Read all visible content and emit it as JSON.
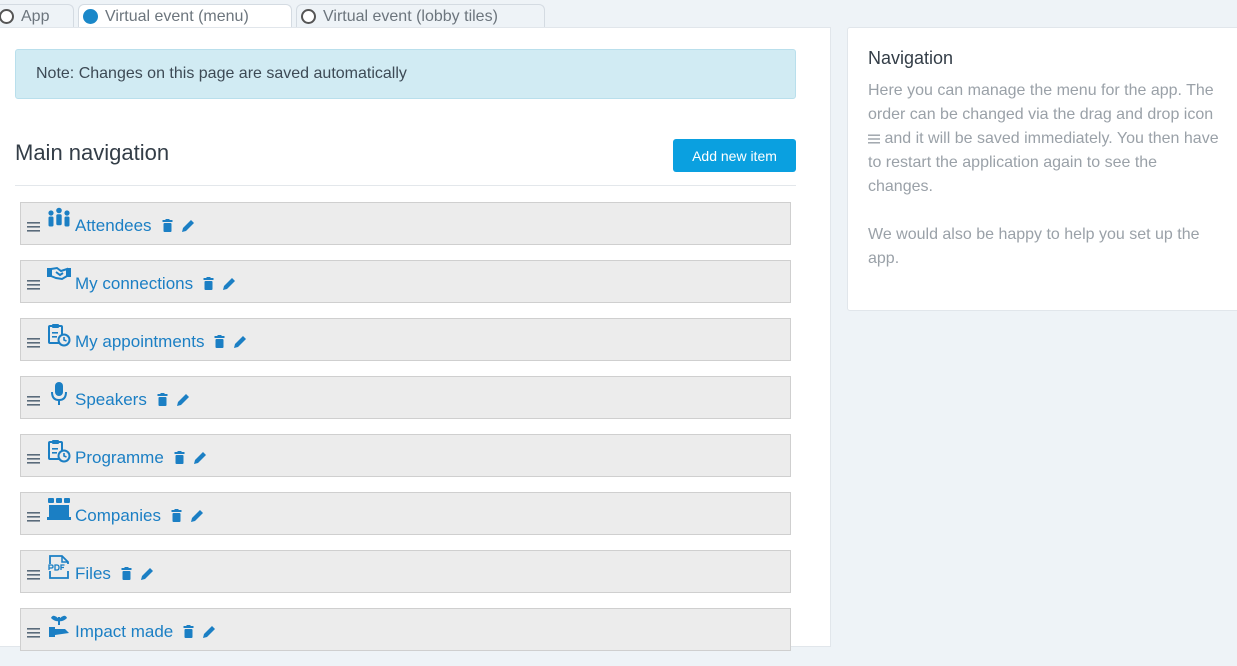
{
  "tabs": [
    {
      "label": "App",
      "active": false
    },
    {
      "label": "Virtual event (menu)",
      "active": true
    },
    {
      "label": "Virtual event (lobby tiles)",
      "active": false
    }
  ],
  "note": "Note: Changes on this page are saved automatically",
  "main": {
    "title": "Main navigation",
    "add_button": "Add new item",
    "items": [
      {
        "label": "Attendees",
        "icon": "people-icon"
      },
      {
        "label": "My connections",
        "icon": "handshake-icon"
      },
      {
        "label": "My appointments",
        "icon": "clipboard-clock-icon"
      },
      {
        "label": "Speakers",
        "icon": "microphone-icon"
      },
      {
        "label": "Programme",
        "icon": "clipboard-clock-icon"
      },
      {
        "label": "Companies",
        "icon": "booth-icon"
      },
      {
        "label": "Files",
        "icon": "pdf-file-icon"
      },
      {
        "label": "Impact made",
        "icon": "plant-icon"
      }
    ]
  },
  "sidebar": {
    "title": "Navigation",
    "text_before_icon": "Here you can manage the menu for the app. The order can be changed via the drag and drop icon",
    "text_after_icon": "and it will be saved immediately. You then have to restart the application again to see the changes.",
    "text2": "We would also be happy to help you set up the app."
  },
  "colors": {
    "accent": "#1b7fc4",
    "button": "#0aa0e0",
    "note_bg": "#d1ebf3"
  }
}
